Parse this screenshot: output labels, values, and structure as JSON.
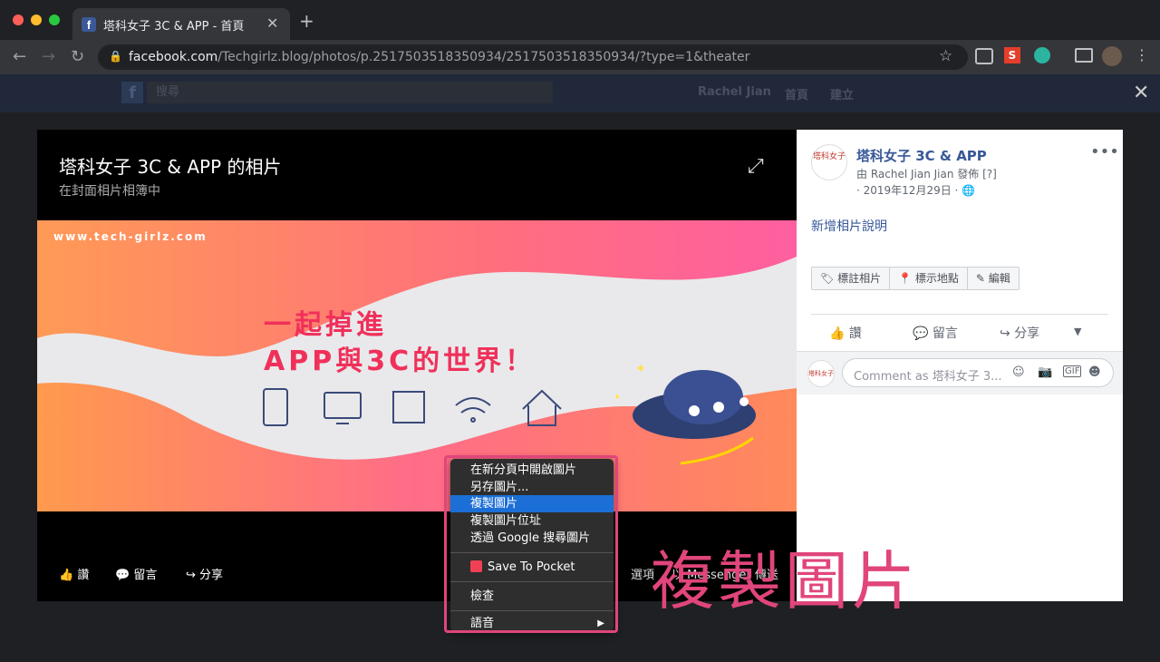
{
  "browser": {
    "tab_title": "塔科女子 3C & APP - 首頁",
    "tab_favicon": "f",
    "url_host": "facebook.com",
    "url_path": "/Techgirlz.blog/photos/p.2517503518350934/2517503518350934/?type=1&theater"
  },
  "fb_header": {
    "search_placeholder": "搜尋",
    "user_name": "Rachel Jian",
    "home": "首頁",
    "create": "建立"
  },
  "theater": {
    "title": "塔科女子 3C & APP 的相片",
    "subtitle": "在封面相片相簿中",
    "photo": {
      "site": "www.tech-girlz.com",
      "line1": "一起掉進",
      "line2": "APP與3C的世界！"
    },
    "actions": {
      "like": "讚",
      "comment": "留言",
      "share": "分享",
      "options": "選項",
      "send": "以 Messenger 傳送"
    }
  },
  "panel": {
    "page_name": "塔科女子 3C & APP",
    "byline": "由 Rachel Jian Jian 發佈 [?]",
    "date": "· 2019年12月29日 ·",
    "caption": "新增相片說明",
    "tag_buttons": [
      "標註相片",
      "標示地點",
      "編輯"
    ],
    "actions": {
      "like": "讚",
      "comment": "留言",
      "share": "分享"
    },
    "comment_placeholder": "Comment as 塔科女子 3...",
    "avatar_text": "塔科女子"
  },
  "context_menu": {
    "items": [
      "在新分頁中開啟圖片",
      "另存圖片...",
      "複製圖片",
      "複製圖片位址",
      "透過 Google 搜尋圖片",
      "Save To Pocket",
      "檢查",
      "語音"
    ],
    "selected_index": 2
  },
  "annotation": "複製圖片",
  "colors": {
    "fb_blue": "#385898",
    "highlight": "#e0457b",
    "menu_select": "#1c6fd6"
  }
}
